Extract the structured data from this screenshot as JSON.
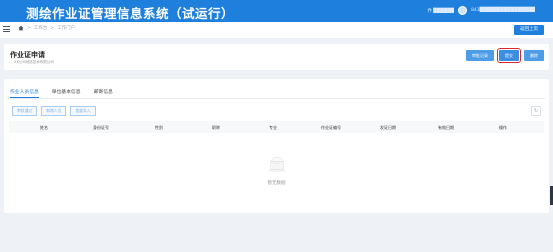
{
  "header": {
    "app_title": "测绘作业证管理信息系统（试运行）",
    "user_name": "乔 ██████",
    "account": "843████████████████"
  },
  "breadcrumb": {
    "items": [
      "工作台",
      "工作门户"
    ],
    "back_label": "返回上页"
  },
  "page": {
    "title": "作业证申请",
    "org_name": "XX公司地信技术有限公司",
    "actions": [
      "审批记录",
      "提交",
      "删除"
    ]
  },
  "tabs": [
    "作业人员信息",
    "单位基本信息",
    "邮寄信息"
  ],
  "toolbar": [
    "审核通过",
    "新增人员",
    "批量导入"
  ],
  "table": {
    "columns": [
      "姓名",
      "身份证号",
      "性别",
      "职称",
      "专业",
      "作业证编号",
      "发证日期",
      "有效日期",
      "操作"
    ],
    "empty_text": "暂无数据"
  }
}
